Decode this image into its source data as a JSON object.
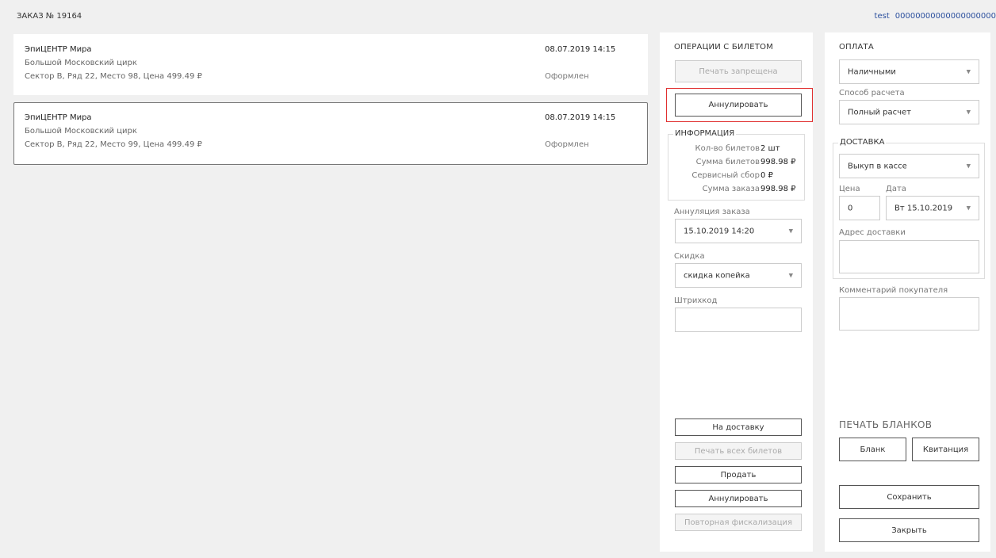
{
  "header": {
    "order_title": "ЗАКАЗ № 19164",
    "user": "test",
    "user_code": "00000000000000000000"
  },
  "tickets": [
    {
      "venue": "ЭпиЦЕНТР Мира",
      "organizer": "Большой Московский цирк",
      "seat": "Сектор B, Ряд 22, Место 98, Цена 499.49 ₽",
      "datetime": "08.07.2019 14:15",
      "status": "Оформлен"
    },
    {
      "venue": "ЭпиЦЕНТР Мира",
      "organizer": "Большой Московский цирк",
      "seat": "Сектор B, Ряд 22, Место 99, Цена 499.49 ₽",
      "datetime": "08.07.2019 14:15",
      "status": "Оформлен"
    }
  ],
  "operations": {
    "title": "ОПЕРАЦИИ С БИЛЕТОМ",
    "print_forbidden": "Печать запрещена",
    "annul": "Аннулировать",
    "info": {
      "title": "ИНФОРМАЦИЯ",
      "rows": [
        {
          "label": "Кол-во билетов",
          "value": "2 шт"
        },
        {
          "label": "Сумма билетов",
          "value": "998.98 ₽"
        },
        {
          "label": "Сервисный сбор",
          "value": "0 ₽"
        },
        {
          "label": "Сумма заказа",
          "value": "998.98 ₽"
        }
      ]
    },
    "annul_date_label": "Аннуляция заказа",
    "annul_date_value": "15.10.2019 14:20",
    "discount_label": "Скидка",
    "discount_value": "скидка копейка",
    "barcode_label": "Штрихкод",
    "barcode_value": "",
    "to_delivery": "На доставку",
    "print_all": "Печать всех билетов",
    "sell": "Продать",
    "annul_bottom": "Аннулировать",
    "refiscal": "Повторная фискализация"
  },
  "payment": {
    "title": "ОПЛАТА",
    "method_value": "Наличными",
    "calc_label": "Способ расчета",
    "calc_value": "Полный расчет",
    "delivery": {
      "title": "ДОСТАВКА",
      "type_value": "Выкуп в кассе",
      "price_label": "Цена",
      "price_value": "0",
      "date_label": "Дата",
      "date_value": "Вт 15.10.2019",
      "address_label": "Адрес доставки",
      "address_value": ""
    },
    "comment_label": "Комментарий покупателя",
    "comment_value": "",
    "print_forms_title": "ПЕЧАТЬ БЛАНКОВ",
    "blank": "Бланк",
    "receipt": "Квитанция",
    "save": "Сохранить",
    "close": "Закрыть"
  },
  "colors": {
    "background": "#f0f0f0",
    "link": "#2b4f9e",
    "highlight": "#e03030"
  }
}
